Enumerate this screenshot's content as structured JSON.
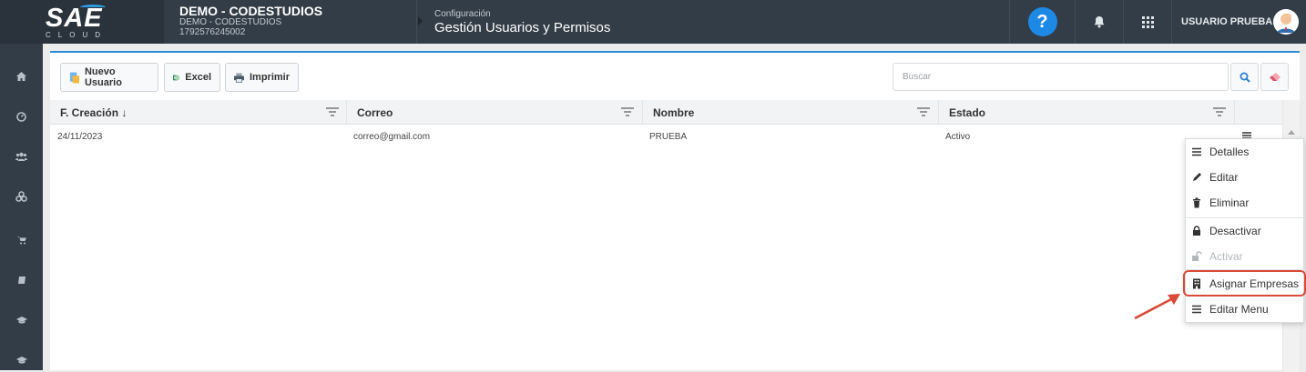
{
  "header": {
    "logo_text": "SAE",
    "logo_sub": "CLOUD",
    "company_name": "DEMO - CODESTUDIOS",
    "company_sub": "DEMO - CODESTUDIOS",
    "company_id": "1792576245002",
    "breadcrumb_section": "Configuración",
    "page_title": "Gestión Usuarios y Permisos",
    "help_label": "?",
    "user_name": "USUARIO PRUEBA",
    "icons": [
      "help-icon",
      "bell-icon",
      "apps-grid-icon",
      "avatar"
    ]
  },
  "sidebar": {
    "icons": [
      "home-icon",
      "dashboard-icon",
      "users-icon",
      "share-icon",
      "cart-icon",
      "book-icon",
      "graduation-icon",
      "graduation-icon"
    ]
  },
  "toolbar": {
    "new_user_label": "Nuevo Usuario",
    "excel_label": "Excel",
    "print_label": "Imprimir",
    "search_placeholder": "Buscar"
  },
  "table": {
    "columns": [
      "F. Creación ↓",
      "Correo",
      "Nombre",
      "Estado"
    ],
    "rows": [
      {
        "fecha": "24/11/2023",
        "correo": "correo@gmail.com",
        "nombre": "PRUEBA",
        "estado": "Activo"
      }
    ]
  },
  "context_menu": {
    "items": [
      {
        "label": "Detalles",
        "icon": "list-icon",
        "enabled": true
      },
      {
        "label": "Editar",
        "icon": "pencil-icon",
        "enabled": true
      },
      {
        "label": "Eliminar",
        "icon": "trash-icon",
        "enabled": true
      },
      {
        "label": "Desactivar",
        "icon": "lock-icon",
        "enabled": true
      },
      {
        "label": "Activar",
        "icon": "unlock-icon",
        "enabled": false
      },
      {
        "label": "Asignar Empresas",
        "icon": "building-icon",
        "enabled": true
      },
      {
        "label": "Editar Menu",
        "icon": "list-icon",
        "enabled": true
      }
    ],
    "highlighted": "Asignar Empresas"
  },
  "colors": {
    "topbar": "#333d47",
    "accent": "#2e8bd6",
    "help": "#1e88e5",
    "annotation": "#d94a38"
  }
}
